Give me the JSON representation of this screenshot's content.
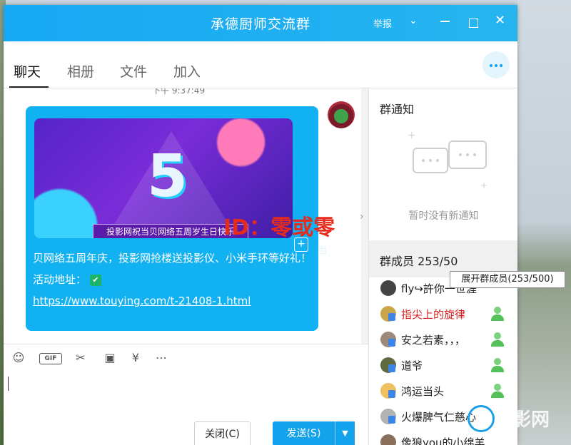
{
  "window": {
    "title": "承德厨师交流群",
    "report_label": "举报"
  },
  "tabs": [
    {
      "label": "聊天",
      "active": true
    },
    {
      "label": "相册",
      "active": false
    },
    {
      "label": "文件",
      "active": false
    },
    {
      "label": "加入",
      "active": false
    }
  ],
  "chat": {
    "timestamp": "下午 9:37:49",
    "promo_banner": "投影网祝当贝网络五周岁生日快乐",
    "promo_extra": "当",
    "message_text": "贝网络五周年庆，投影网抢楼送投影仪、小米手环等好礼！活动地址：",
    "message_link": "https://www.touying.com/t-21408-1.html",
    "watermark": "ID：零或零"
  },
  "toolbar": {
    "gif_label": "GIF",
    "close_label": "关闭(C)",
    "send_label": "发送(S)"
  },
  "right_panel": {
    "notice_title": "群通知",
    "notice_empty": "暂时没有新通知",
    "members_title": "群成员 253/50",
    "tooltip": "展开群成员(253/500)",
    "members": [
      {
        "name": "fly↪許你一世涯"
      },
      {
        "name": "指尖上的旋律"
      },
      {
        "name": "安之若素，，，"
      },
      {
        "name": "道爷"
      },
      {
        "name": "鸿运当头"
      },
      {
        "name": "火爆脾气仁慈心"
      },
      {
        "name": "像狼you的小绵羊"
      }
    ]
  },
  "branding": {
    "logo_text": "投影网"
  },
  "colors": {
    "accent": "#12a3ec",
    "bubble": "#12b1f2",
    "name_red": "#d82020"
  }
}
